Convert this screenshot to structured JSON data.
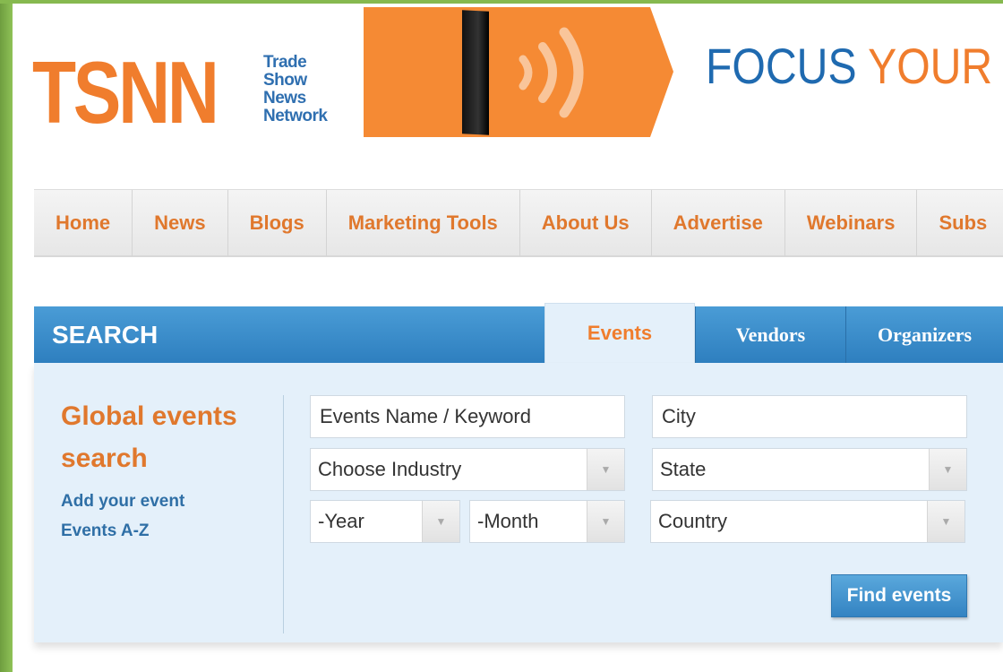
{
  "logo": {
    "main": "TSNN",
    "lines": [
      "Trade",
      "Show",
      "News",
      "Network"
    ]
  },
  "banner": {
    "tagline_a": "FOCUS ",
    "tagline_b": "YOUR"
  },
  "nav": {
    "items": [
      "Home",
      "News",
      "Blogs",
      "Marketing Tools",
      "About Us",
      "Advertise",
      "Webinars",
      "Subs"
    ]
  },
  "search": {
    "title": "SEARCH",
    "tabs": [
      "Events",
      "Vendors",
      "Organizers"
    ],
    "heading_line1": "Global events",
    "heading_line2": "search",
    "links": [
      "Add your event",
      "Events A-Z"
    ],
    "keyword_placeholder": "Events Name / Keyword",
    "city_placeholder": "City",
    "industry": "Choose Industry",
    "state": "State",
    "year": "-Year",
    "month": "-Month",
    "country": "Country",
    "find_button": "Find events"
  },
  "colors": {
    "brand_orange": "#f07d2d",
    "brand_blue": "#2e7fbf",
    "panel_bg": "#e4f0fa"
  }
}
